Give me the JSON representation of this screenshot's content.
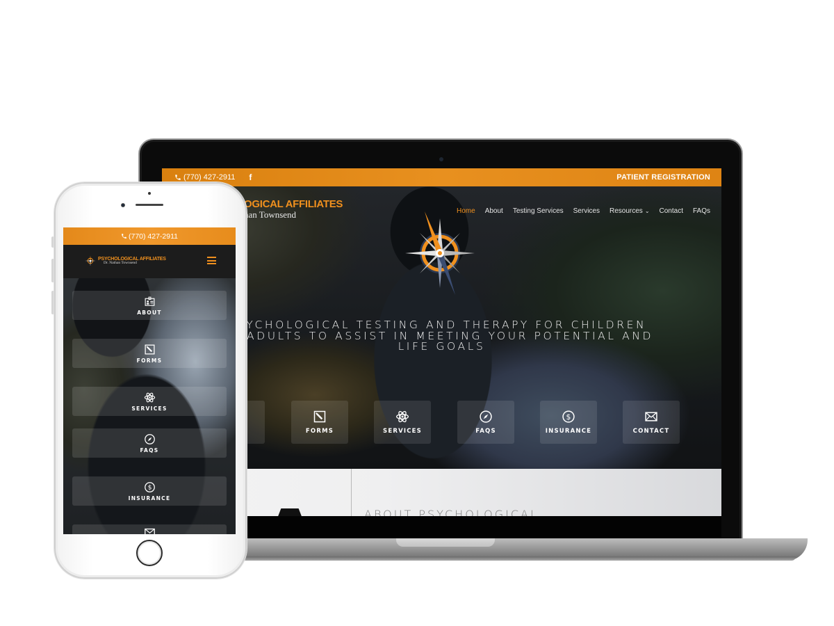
{
  "laptop": {
    "topbar": {
      "phone": "(770) 427-2911",
      "facebook_icon": "f",
      "registration_link": "PATIENT REGISTRATION"
    },
    "brand": {
      "line1": "OGICAL AFFILIATES",
      "line2": "han Townsend"
    },
    "nav": {
      "items": [
        {
          "label": "Home",
          "active": true
        },
        {
          "label": "About"
        },
        {
          "label": "Testing Services"
        },
        {
          "label": "Services"
        },
        {
          "label": "Resources",
          "dropdown": true
        },
        {
          "label": "Contact"
        },
        {
          "label": "FAQs"
        }
      ]
    },
    "hero": {
      "headline_lines": [
        "SYCHOLOGICAL TESTING AND THERAPY FOR CHILDREN",
        "D ADULTS TO ASSIST IN MEETING YOUR POTENTIAL AND",
        "LIFE GOALS"
      ]
    },
    "tiles": [
      {
        "label": "T",
        "icon": "id-badge-icon"
      },
      {
        "label": "FORMS",
        "icon": "edit-icon"
      },
      {
        "label": "SERVICES",
        "icon": "atom-icon"
      },
      {
        "label": "FAQS",
        "icon": "compass-icon"
      },
      {
        "label": "INSURANCE",
        "icon": "dollar-icon"
      },
      {
        "label": "CONTACT",
        "icon": "envelope-icon"
      }
    ],
    "about_heading": "ABOUT PSYCHOLOGICAL"
  },
  "phone": {
    "topbar_phone": "(770) 427-2911",
    "brand": {
      "line1": "PSYCHOLOGICAL AFFILIATES",
      "line2": "Dr. Nathan Townsend"
    },
    "tiles": [
      {
        "label": "ABOUT",
        "icon": "id-badge-icon"
      },
      {
        "label": "FORMS",
        "icon": "edit-icon"
      },
      {
        "label": "SERVICES",
        "icon": "atom-icon"
      },
      {
        "label": "FAQS",
        "icon": "compass-icon"
      },
      {
        "label": "INSURANCE",
        "icon": "dollar-icon"
      },
      {
        "label": "",
        "icon": "envelope-icon"
      }
    ]
  },
  "colors": {
    "accent_orange": "#e8901f",
    "dark_bg": "#15191c",
    "text_light": "#f2f2f2"
  }
}
